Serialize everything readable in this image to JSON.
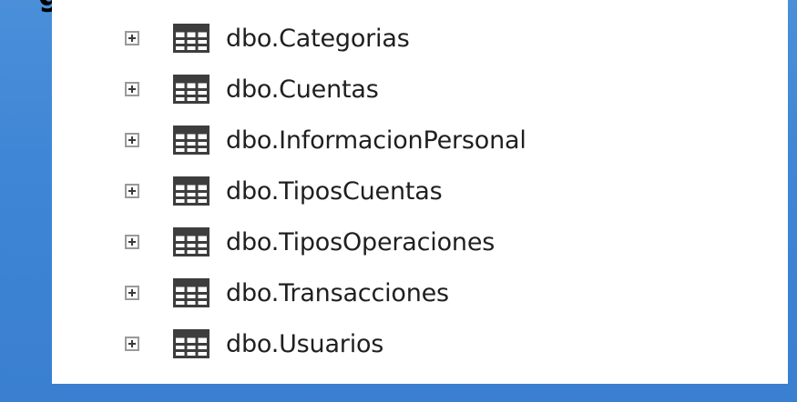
{
  "header": {
    "partial_label": "g"
  },
  "tree": {
    "items": [
      {
        "label": "dbo.Categorias",
        "icon": "table-icon",
        "expander": "plus-expand-icon"
      },
      {
        "label": "dbo.Cuentas",
        "icon": "table-icon",
        "expander": "plus-expand-icon"
      },
      {
        "label": "dbo.InformacionPersonal",
        "icon": "table-icon",
        "expander": "plus-expand-icon"
      },
      {
        "label": "dbo.TiposCuentas",
        "icon": "table-icon",
        "expander": "plus-expand-icon"
      },
      {
        "label": "dbo.TiposOperaciones",
        "icon": "table-icon",
        "expander": "plus-expand-icon"
      },
      {
        "label": "dbo.Transacciones",
        "icon": "table-icon",
        "expander": "plus-expand-icon"
      },
      {
        "label": "dbo.Usuarios",
        "icon": "table-icon",
        "expander": "plus-expand-icon"
      }
    ]
  },
  "colors": {
    "background_blue": "#3f86d6",
    "panel": "#ffffff",
    "text": "#1f1f1f",
    "icon_stroke": "#3d3d3d"
  }
}
